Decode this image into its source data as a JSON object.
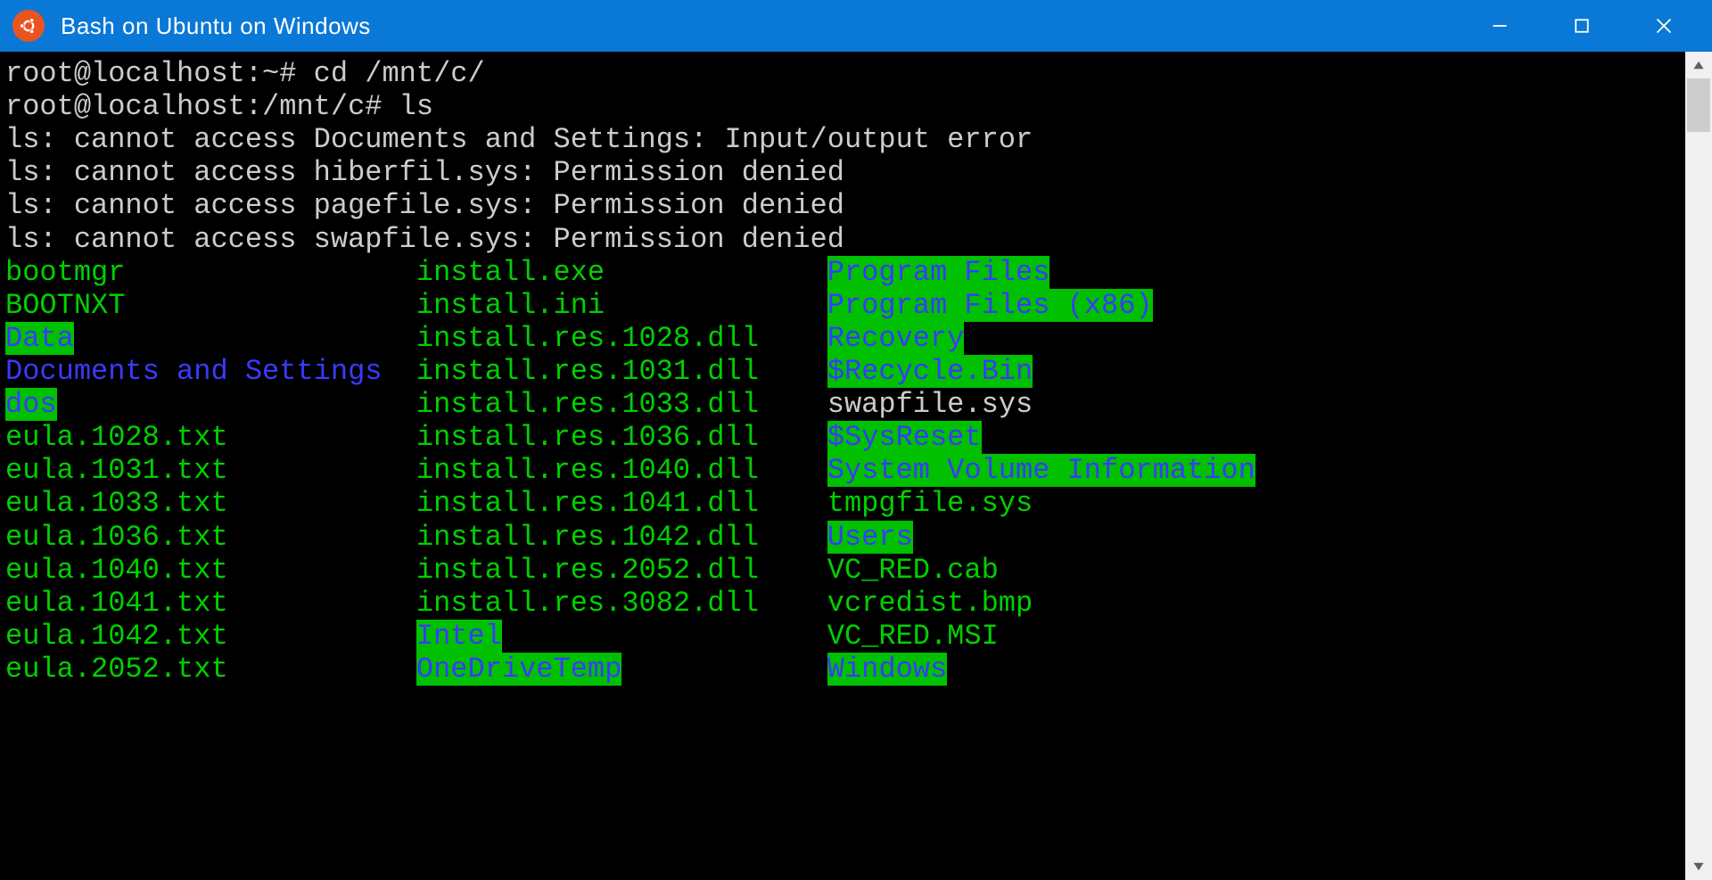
{
  "window": {
    "title": "Bash on Ubuntu on Windows"
  },
  "terminal_lines": [
    "root@localhost:~# cd /mnt/c/",
    "root@localhost:/mnt/c# ls",
    "ls: cannot access Documents and Settings: Input/output error",
    "ls: cannot access hiberfil.sys: Permission denied",
    "ls: cannot access pagefile.sys: Permission denied",
    "ls: cannot access swapfile.sys: Permission denied"
  ],
  "listing": {
    "columns": [
      [
        {
          "text": "bootmgr",
          "style": "green"
        },
        {
          "text": "BOOTNXT",
          "style": "green"
        },
        {
          "text": "Data",
          "style": "dirhi"
        },
        {
          "text": "Documents and Settings",
          "style": "dirblue"
        },
        {
          "text": "dos",
          "style": "dirhi"
        },
        {
          "text": "eula.1028.txt",
          "style": "green"
        },
        {
          "text": "eula.1031.txt",
          "style": "green"
        },
        {
          "text": "eula.1033.txt",
          "style": "green"
        },
        {
          "text": "eula.1036.txt",
          "style": "green"
        },
        {
          "text": "eula.1040.txt",
          "style": "green"
        },
        {
          "text": "eula.1041.txt",
          "style": "green"
        },
        {
          "text": "eula.1042.txt",
          "style": "green"
        },
        {
          "text": "eula.2052.txt",
          "style": "green"
        }
      ],
      [
        {
          "text": "install.exe",
          "style": "green"
        },
        {
          "text": "install.ini",
          "style": "green"
        },
        {
          "text": "install.res.1028.dll",
          "style": "green"
        },
        {
          "text": "install.res.1031.dll",
          "style": "green"
        },
        {
          "text": "install.res.1033.dll",
          "style": "green"
        },
        {
          "text": "install.res.1036.dll",
          "style": "green"
        },
        {
          "text": "install.res.1040.dll",
          "style": "green"
        },
        {
          "text": "install.res.1041.dll",
          "style": "green"
        },
        {
          "text": "install.res.1042.dll",
          "style": "green"
        },
        {
          "text": "install.res.2052.dll",
          "style": "green"
        },
        {
          "text": "install.res.3082.dll",
          "style": "green"
        },
        {
          "text": "Intel",
          "style": "dirhi"
        },
        {
          "text": "OneDriveTemp",
          "style": "dirhi"
        }
      ],
      [
        {
          "text": "Program Files",
          "style": "dirhi"
        },
        {
          "text": "Program Files (x86)",
          "style": "dirhi"
        },
        {
          "text": "Recovery",
          "style": "dirhi"
        },
        {
          "text": "$Recycle.Bin",
          "style": "dirhi"
        },
        {
          "text": "swapfile.sys",
          "style": "plain"
        },
        {
          "text": "$SysReset",
          "style": "dirhi"
        },
        {
          "text": "System Volume Information",
          "style": "dirhi"
        },
        {
          "text": "tmpgfile.sys",
          "style": "green"
        },
        {
          "text": "Users",
          "style": "dirhi"
        },
        {
          "text": "VC_RED.cab",
          "style": "green"
        },
        {
          "text": "vcredist.bmp",
          "style": "green"
        },
        {
          "text": "VC_RED.MSI",
          "style": "green"
        },
        {
          "text": "Windows",
          "style": "dirhi"
        }
      ]
    ],
    "col_char_widths": [
      24,
      24,
      0
    ]
  }
}
